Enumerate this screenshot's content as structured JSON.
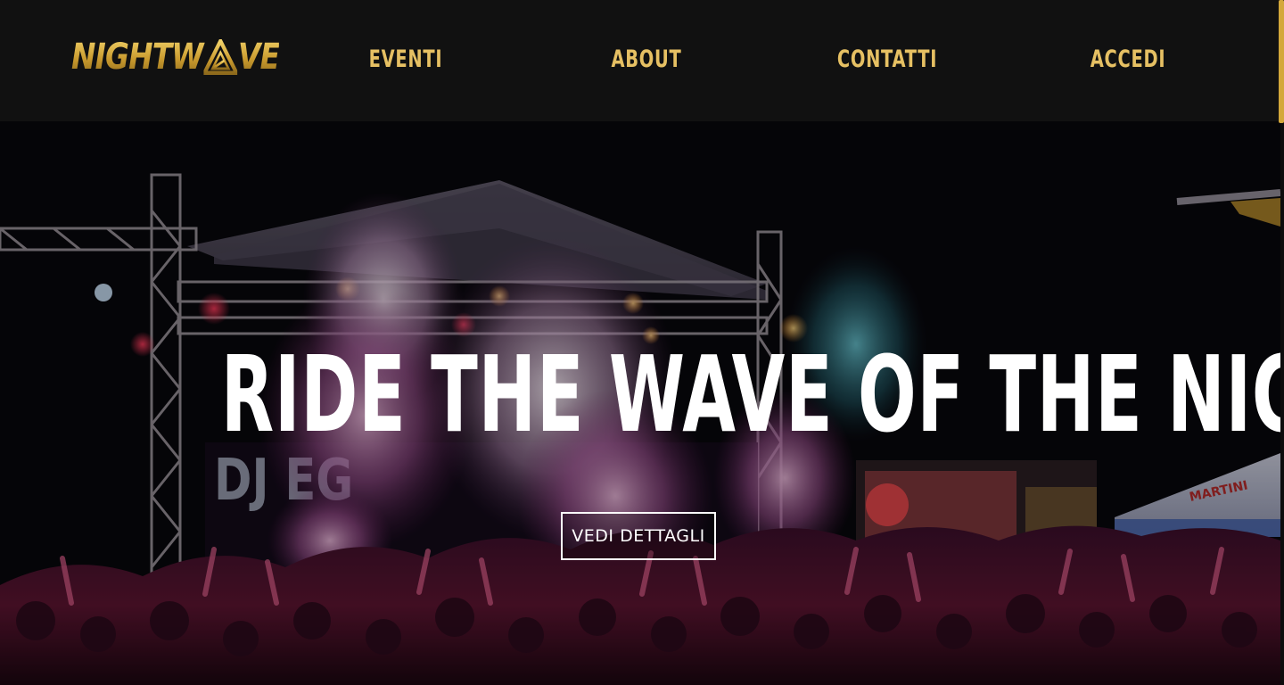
{
  "brand": {
    "logo_text_left": "NIGHTW",
    "logo_text_right": "VE",
    "logo_color": "#d4a83b"
  },
  "nav": {
    "items": [
      {
        "label": "EVENTI"
      },
      {
        "label": "ABOUT"
      },
      {
        "label": "CONTATTI"
      },
      {
        "label": "ACCEDI"
      }
    ],
    "link_color": "#e6c063",
    "background": "#111111"
  },
  "hero": {
    "title": "RIDE THE WAVE OF THE NIGHT",
    "cta_label": "VEDI DETTAGLI",
    "background_image": "concert-crowd-photo"
  }
}
